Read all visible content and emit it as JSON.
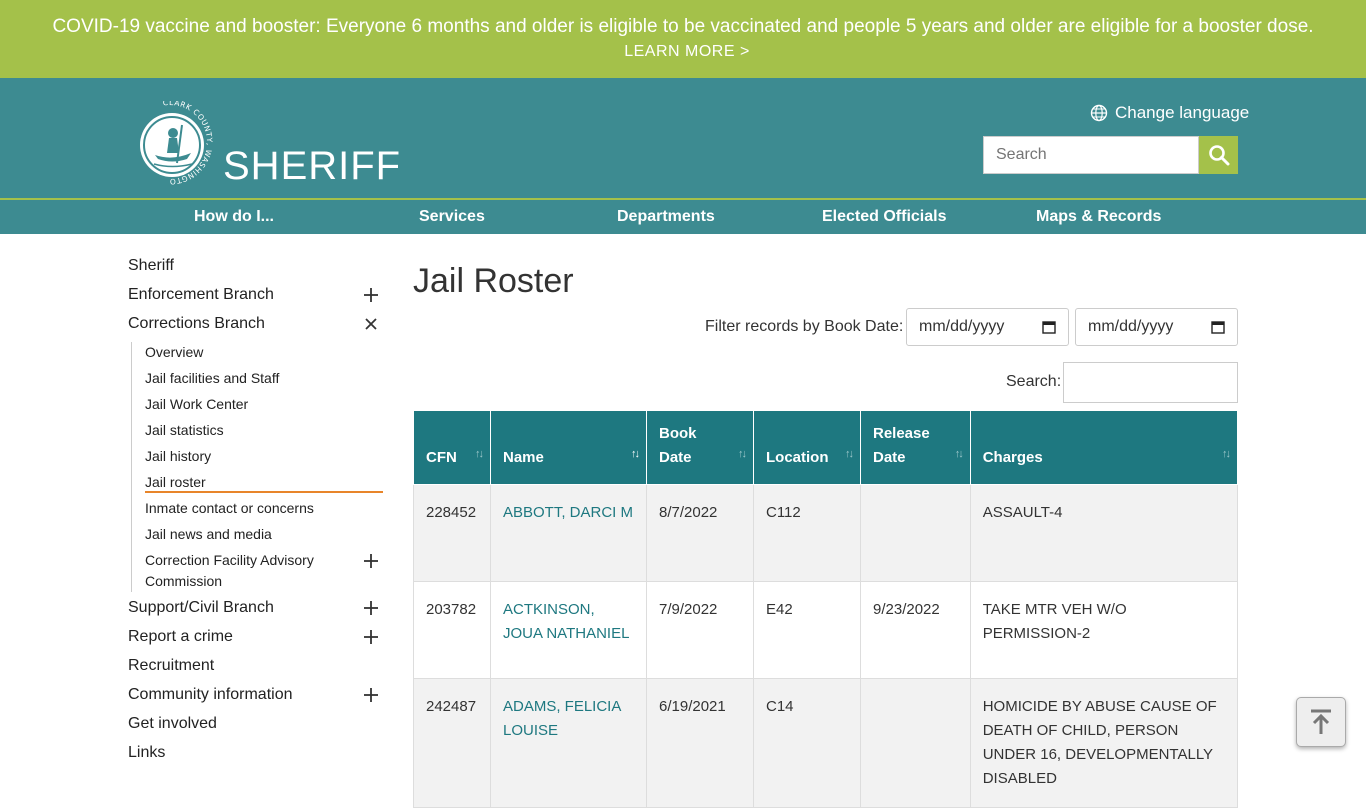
{
  "alert": {
    "text": "COVID-19 vaccine and booster: Everyone 6 months and older is eligible to be vaccinated and people 5 years and older are eligible for a booster dose.",
    "link_label": "LEARN MORE >"
  },
  "header": {
    "logo_ring_text": "CLARK COUNTY, WASHINGTON",
    "site_name": "SHERIFF",
    "language_label": "Change language",
    "search_placeholder": "Search"
  },
  "nav": {
    "items": [
      "How do I...",
      "Services",
      "Departments",
      "Elected Officials",
      "Maps & Records"
    ]
  },
  "sidebar": {
    "items": [
      {
        "label": "Sheriff"
      },
      {
        "label": "Enforcement Branch"
      },
      {
        "label": "Corrections Branch"
      },
      {
        "label": "Support/Civil Branch"
      },
      {
        "label": "Report a crime"
      },
      {
        "label": "Recruitment"
      },
      {
        "label": "Community information"
      },
      {
        "label": "Get involved"
      },
      {
        "label": "Links"
      }
    ],
    "sub_items": [
      {
        "label": "Overview"
      },
      {
        "label": "Jail facilities and Staff"
      },
      {
        "label": "Jail Work Center"
      },
      {
        "label": "Jail statistics"
      },
      {
        "label": "Jail history"
      },
      {
        "label": "Jail roster"
      },
      {
        "label": "Inmate contact or concerns"
      },
      {
        "label": "Jail news and media"
      },
      {
        "label": "Correction Facility Advisory Commission"
      }
    ]
  },
  "main": {
    "title": "Jail Roster",
    "filter_label": "Filter records by Book Date:",
    "date_placeholder": "mm/dd/yyyy",
    "search_label": "Search:",
    "table": {
      "headers": [
        "CFN",
        "Name",
        "Book Date",
        "Location",
        "Release Date",
        "Charges"
      ],
      "rows": [
        {
          "cfn": "228452",
          "name": "ABBOTT, DARCI M",
          "book_date": "8/7/2022",
          "location": "C112",
          "release_date": "",
          "charges": "ASSAULT-4"
        },
        {
          "cfn": "203782",
          "name": "ACTKINSON, JOUA NATHANIEL",
          "book_date": "7/9/2022",
          "location": "E42",
          "release_date": "9/23/2022",
          "charges": "TAKE MTR VEH W/O PERMISSION-2"
        },
        {
          "cfn": "242487",
          "name": "ADAMS, FELICIA LOUISE",
          "book_date": "6/19/2021",
          "location": "C14",
          "release_date": "",
          "charges": "HOMICIDE BY ABUSE CAUSE OF DEATH OF CHILD, PERSON UNDER 16, DEVELOPMENTALLY DISABLED"
        }
      ]
    }
  },
  "colors": {
    "alert_bg": "#a4c14a",
    "header_bg": "#3d8b91",
    "table_header_bg": "#1e7880",
    "link": "#1e7880",
    "active_underline": "#e8852a"
  }
}
